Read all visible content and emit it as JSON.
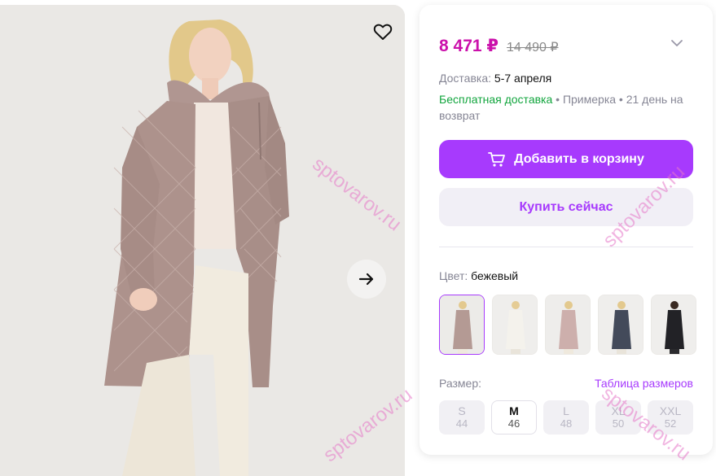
{
  "product": {
    "price_current": "8 471 ₽",
    "price_old": "14 490 ₽"
  },
  "shipping": {
    "label": "Доставка:",
    "date": "5-7 апреля",
    "free_delivery": "Бесплатная доставка",
    "rest": "• Примерка • 21 день на возврат"
  },
  "actions": {
    "add_to_cart": "Добавить в корзину",
    "buy_now": "Купить сейчас"
  },
  "color": {
    "label": "Цвет:",
    "value": "бежевый",
    "swatches": [
      {
        "name": "бежевый",
        "tone": "#b59d96",
        "active": true
      },
      {
        "name": "white",
        "tone": "#ebe8e2",
        "active": false
      },
      {
        "name": "rose",
        "tone": "#c9a9a6",
        "active": false
      },
      {
        "name": "navy",
        "tone": "#434a5a",
        "active": false
      },
      {
        "name": "black",
        "tone": "#222226",
        "active": false
      }
    ]
  },
  "size": {
    "label": "Размер:",
    "table_link": "Таблица размеров",
    "options": [
      {
        "letter": "S",
        "number": "44",
        "available": false
      },
      {
        "letter": "M",
        "number": "46",
        "available": true
      },
      {
        "letter": "L",
        "number": "48",
        "available": false
      },
      {
        "letter": "XL",
        "number": "50",
        "available": false
      },
      {
        "letter": "XXL",
        "number": "52",
        "available": false
      }
    ]
  },
  "watermark": "sptovarov.ru",
  "colors": {
    "accent": "#a73afd",
    "price": "#cb11ab",
    "free": "#11a53d"
  },
  "icons": {
    "favorite": "heart-icon",
    "next": "arrow-right-icon",
    "cart": "cart-icon",
    "expand": "chevron-down-icon"
  }
}
